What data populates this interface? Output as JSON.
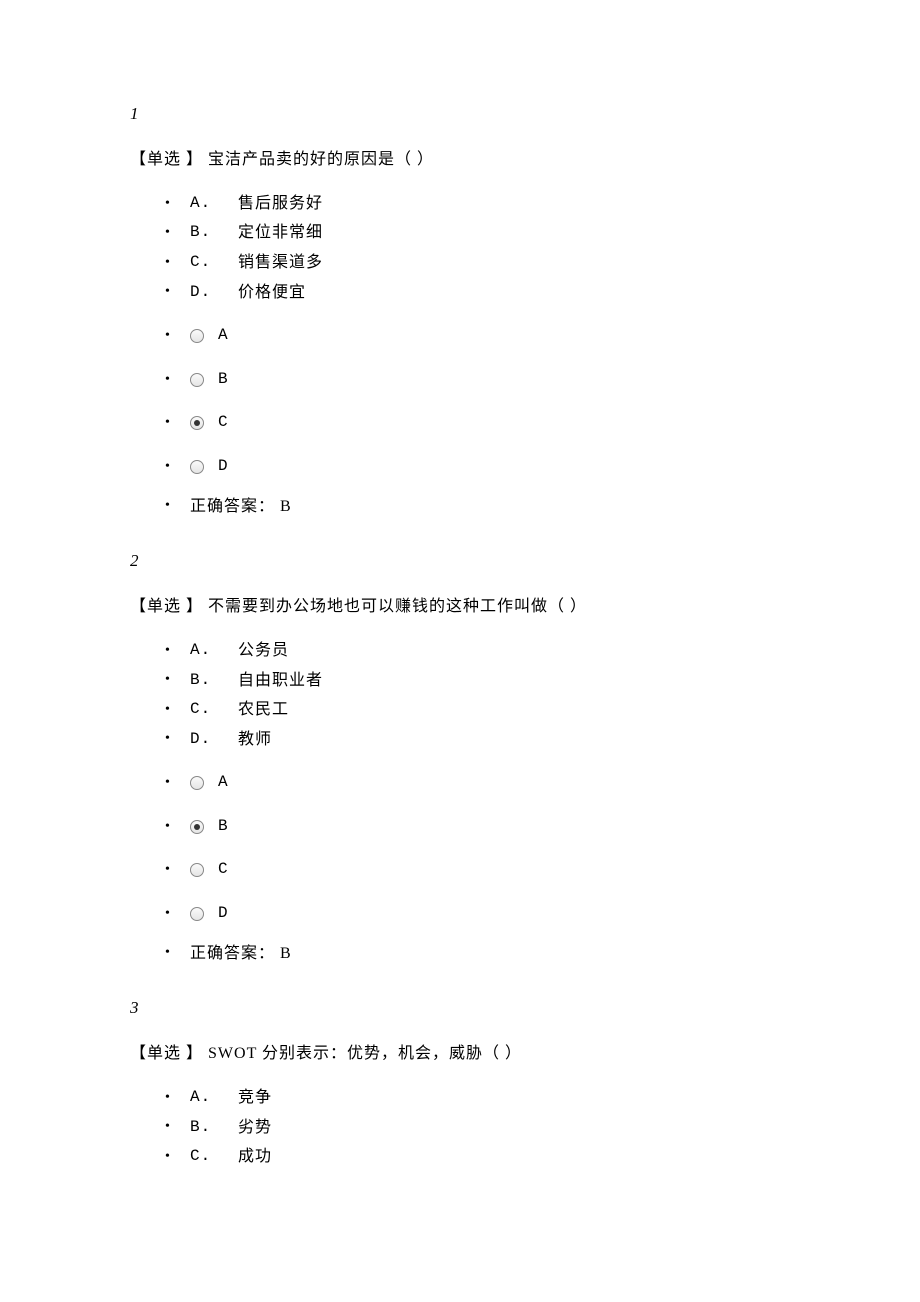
{
  "questions": [
    {
      "number": "1",
      "tag": "【单选 】",
      "title": " 宝洁产品卖的好的原因是（ ）",
      "choices": [
        {
          "label": "A.",
          "text": "售后服务好"
        },
        {
          "label": "B.",
          "text": "定位非常细"
        },
        {
          "label": "C.",
          "text": "销售渠道多"
        },
        {
          "label": "D.",
          "text": "价格便宜"
        }
      ],
      "radios": [
        {
          "label": "A",
          "selected": false
        },
        {
          "label": "B",
          "selected": false
        },
        {
          "label": "C",
          "selected": true
        },
        {
          "label": "D",
          "selected": false
        }
      ],
      "answer": "正确答案： B"
    },
    {
      "number": "2",
      "tag": "【单选 】",
      "title": " 不需要到办公场地也可以赚钱的这种工作叫做（ ）",
      "choices": [
        {
          "label": "A.",
          "text": "公务员"
        },
        {
          "label": "B.",
          "text": "自由职业者"
        },
        {
          "label": "C.",
          "text": "农民工"
        },
        {
          "label": "D.",
          "text": "教师"
        }
      ],
      "radios": [
        {
          "label": "A",
          "selected": false
        },
        {
          "label": "B",
          "selected": true
        },
        {
          "label": "C",
          "selected": false
        },
        {
          "label": "D",
          "selected": false
        }
      ],
      "answer": "正确答案： B"
    },
    {
      "number": "3",
      "tag": "【单选 】",
      "title": " SWOT 分别表示：优势，机会，威胁（ ）",
      "choices": [
        {
          "label": "A.",
          "text": "竞争"
        },
        {
          "label": "B.",
          "text": "劣势"
        },
        {
          "label": "C.",
          "text": "成功"
        }
      ],
      "radios": [],
      "answer": null
    }
  ]
}
